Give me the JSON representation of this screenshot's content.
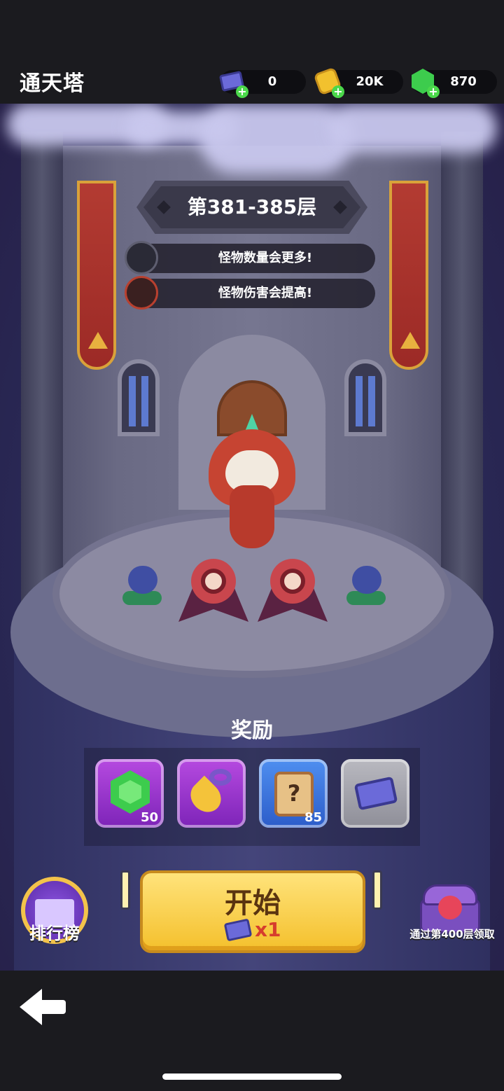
{
  "header": {
    "title": "通天塔",
    "resources": [
      {
        "name": "ticket",
        "icon": "ticket-icon",
        "value": "0"
      },
      {
        "name": "gold",
        "icon": "gold-coin-icon",
        "value": "20K"
      },
      {
        "name": "gem",
        "icon": "green-gem-icon",
        "value": "870"
      }
    ]
  },
  "stage": {
    "floor_range": "第381-385层",
    "modifiers": [
      {
        "icon": "monster-count-icon",
        "text": "怪物数量会更多!"
      },
      {
        "icon": "monster-damage-icon",
        "text": "怪物伤害会提高!"
      }
    ]
  },
  "rewards": {
    "title": "奖励",
    "items": [
      {
        "icon": "green-gem-icon",
        "count": "50",
        "color": "#9a35d0"
      },
      {
        "icon": "golden-key-icon",
        "count": "",
        "color": "#9a35d0"
      },
      {
        "icon": "scroll-icon",
        "count": "85",
        "color": "#3d74df"
      },
      {
        "icon": "ticket-icon",
        "count": "",
        "color": "#a3a3ac"
      }
    ]
  },
  "actions": {
    "start_label": "开始",
    "start_cost": "x1",
    "leaderboard_label": "排行榜",
    "chest_label": "通过第400层领取"
  },
  "colors": {
    "accent_gold": "#f4c02c",
    "gem_green": "#3dcc4d",
    "cost_red": "#d63d2d"
  }
}
